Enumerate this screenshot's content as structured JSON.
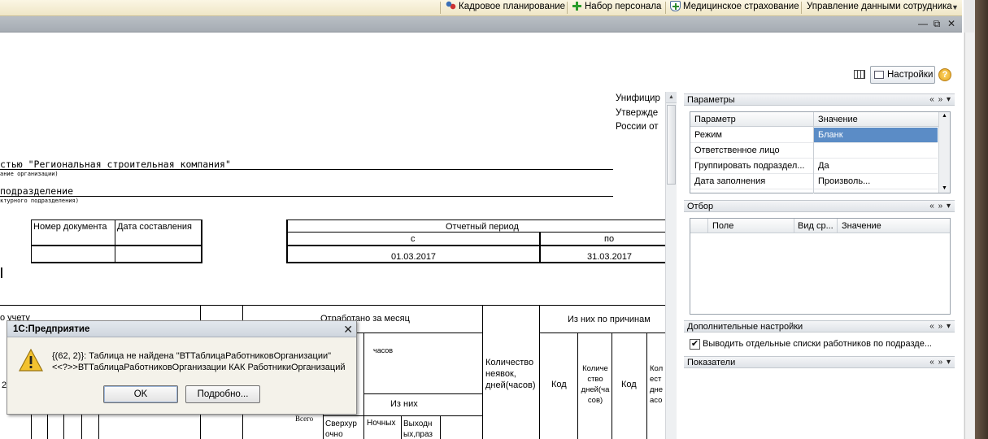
{
  "toolbar": {
    "items": [
      {
        "label": "Кадровое планирование",
        "icon": "people-plan-icon"
      },
      {
        "label": "Набор персонала",
        "icon": "add-person-icon"
      },
      {
        "label": "Медицинское страхование",
        "icon": "medical-shield-icon"
      },
      {
        "label": "Управление данными сотрудника",
        "icon": ""
      }
    ],
    "more_icon": "chevron-down-icon"
  },
  "window": {
    "controls": [
      "—",
      "⧉",
      "✕"
    ]
  },
  "form": {
    "settings_label": "Настройки",
    "help_glyph": "?"
  },
  "document": {
    "right_header": [
      "Унифицир",
      "Утвержде",
      "России от"
    ],
    "org_name": "стью \"Региональная строительная компания\"",
    "org_caption": "ание организации)",
    "dept_name": "подразделение",
    "dept_caption": "ктурного подразделения)",
    "doc_number_label": "Номер документа",
    "doc_date_label": "Дата составления",
    "period_label": "Отчетный период",
    "period_from_label": "с",
    "period_to_label": "по",
    "period_from": "01.03.2017",
    "period_to": "31.03.2017",
    "worked_label": "Отработано за месяц",
    "reasons_label": "Из них по причинам",
    "hours_label": "часов",
    "of_them_label": "Из них",
    "absence_label": "Количество\nнеявок,\nдней(часов)",
    "code1": "Код",
    "days_hours": "Количе\nство\nдней(ча\nсов)",
    "code2": "Код",
    "count_partial": "Кол\nест\nдне\nасо",
    "total_label": "Всего",
    "overtime_label": "Сверхур\nочно",
    "night_label": "Ночных",
    "holiday_label": "Выходн\nых,праз",
    "cut_num": "2",
    "cut_text": "о учету"
  },
  "params_panel": {
    "title": "Параметры",
    "ctrl": "« » ▾",
    "columns": [
      "Параметр",
      "Значение"
    ],
    "rows": [
      {
        "param": "Режим",
        "value": "Бланк",
        "selected": true
      },
      {
        "param": "Ответственное лицо",
        "value": ""
      },
      {
        "param": "Группировать подраздел...",
        "value": "Да"
      },
      {
        "param": "Дата заполнения",
        "value": "Произволь..."
      }
    ]
  },
  "filter_panel": {
    "title": "Отбор",
    "ctrl": "« » ▾",
    "columns": [
      "Поле",
      "Вид ср...",
      "Значение"
    ]
  },
  "extra_panel": {
    "title": "Дополнительные настройки",
    "ctrl": "« » ▾",
    "checkbox_label": "Выводить отдельные списки работников по подразде...",
    "checked": true
  },
  "indicators_panel": {
    "title": "Показатели",
    "ctrl": "« » ▾"
  },
  "dialog": {
    "title": "1С:Предприятие",
    "close": "✕",
    "message_line1": "{(62, 2)}: Таблица не найдена \"ВТТаблицаРаботниковОрганизации\"",
    "message_line2": "<<?>>ВТТаблицаРаботниковОрганизации КАК РаботникиОрганизаций",
    "ok_label": "OK",
    "details_label": "Подробно..."
  },
  "colors": {
    "selection": "#5b8cc6",
    "toolbar_bg": "#f3ecd2",
    "warning": "#f2c230"
  }
}
